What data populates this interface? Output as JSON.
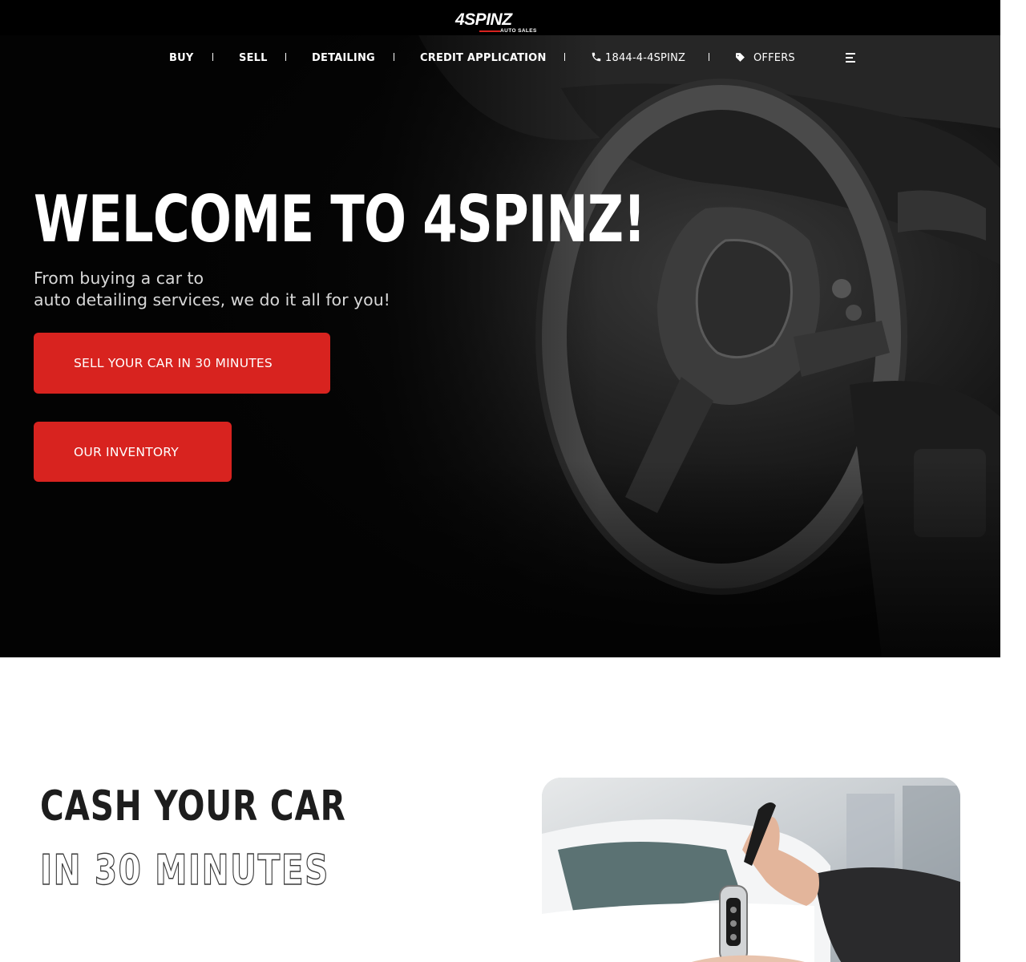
{
  "brand": {
    "logo_text": "4SPINZ",
    "logo_subtext": "AUTO SALES",
    "accent_color": "#d8231f"
  },
  "nav": {
    "items": [
      {
        "label": "BUY"
      },
      {
        "label": "SELL"
      },
      {
        "label": "DETAILING"
      },
      {
        "label": "CREDIT APPLICATION"
      }
    ],
    "phone": {
      "label": "1844-4-4SPINZ",
      "icon": "phone-icon"
    },
    "offers": {
      "label": "OFFERS",
      "icon": "tag-icon"
    },
    "menu_icon": "hamburger-menu-icon"
  },
  "hero": {
    "title": "WELCOME TO 4SPINZ!",
    "subtitle_line1": "From buying a car to",
    "subtitle_line2": "auto detailing services, we do it all for you!",
    "primary_button": "SELL YOUR CAR IN 30 MINUTES",
    "secondary_button": "OUR INVENTORY",
    "background": "car-interior-steering-wheel-photo"
  },
  "cash_section": {
    "title": "CASH YOUR CAR",
    "subtitle": "IN 30 MINUTES",
    "image": "hand-handing-car-key-photo"
  }
}
